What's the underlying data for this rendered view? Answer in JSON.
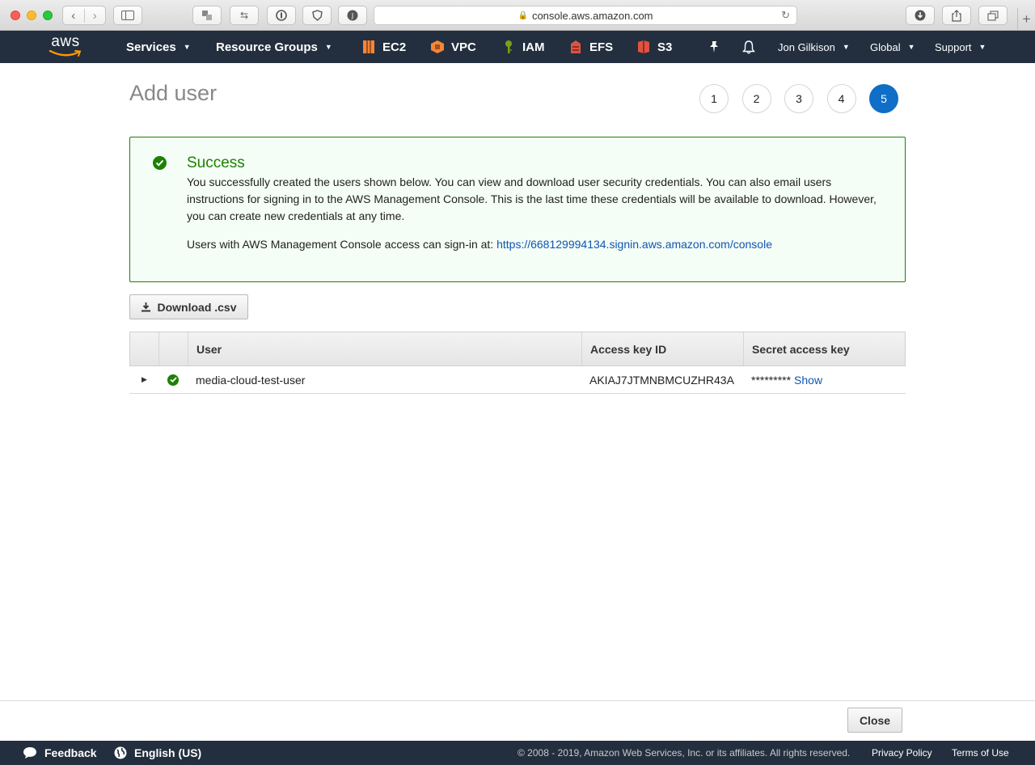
{
  "browser": {
    "url": "console.aws.amazon.com"
  },
  "aws_nav": {
    "logo_text": "aws",
    "services": "Services",
    "resource_groups": "Resource Groups",
    "shortcuts": [
      {
        "label": "EC2",
        "color": "#f58536"
      },
      {
        "label": "VPC",
        "color": "#f58536"
      },
      {
        "label": "IAM",
        "color": "#7aa116"
      },
      {
        "label": "EFS",
        "color": "#e05243"
      },
      {
        "label": "S3",
        "color": "#e05243"
      }
    ],
    "account": "Jon Gilkison",
    "region": "Global",
    "support": "Support"
  },
  "page": {
    "title": "Add user",
    "steps": [
      "1",
      "2",
      "3",
      "4",
      "5"
    ],
    "active_step": "5"
  },
  "success": {
    "title": "Success",
    "message": "You successfully created the users shown below. You can view and download user security credentials. You can also email users instructions for signing in to the AWS Management Console. This is the last time these credentials will be available to download. However, you can create new credentials at any time.",
    "signin_prefix": "Users with AWS Management Console access can sign-in at:",
    "signin_url": "https://668129994134.signin.aws.amazon.com/console"
  },
  "download_button": "Download .csv",
  "table": {
    "columns": [
      "User",
      "Access key ID",
      "Secret access key"
    ],
    "rows": [
      {
        "user": "media-cloud-test-user",
        "access_key_id": "AKIAJ7JTMNBMCUZHR43A",
        "secret_masked": "*********",
        "secret_action": "Show"
      }
    ]
  },
  "close_button": "Close",
  "footer": {
    "feedback": "Feedback",
    "language": "English (US)",
    "copyright": "© 2008 - 2019, Amazon Web Services, Inc. or its affiliates. All rights reserved.",
    "privacy": "Privacy Policy",
    "terms": "Terms of Use"
  },
  "colors": {
    "nav_bg": "#232f3e",
    "success_green": "#1d8102",
    "link_blue": "#0f56b3",
    "active_step_blue": "#0f6ec7"
  }
}
